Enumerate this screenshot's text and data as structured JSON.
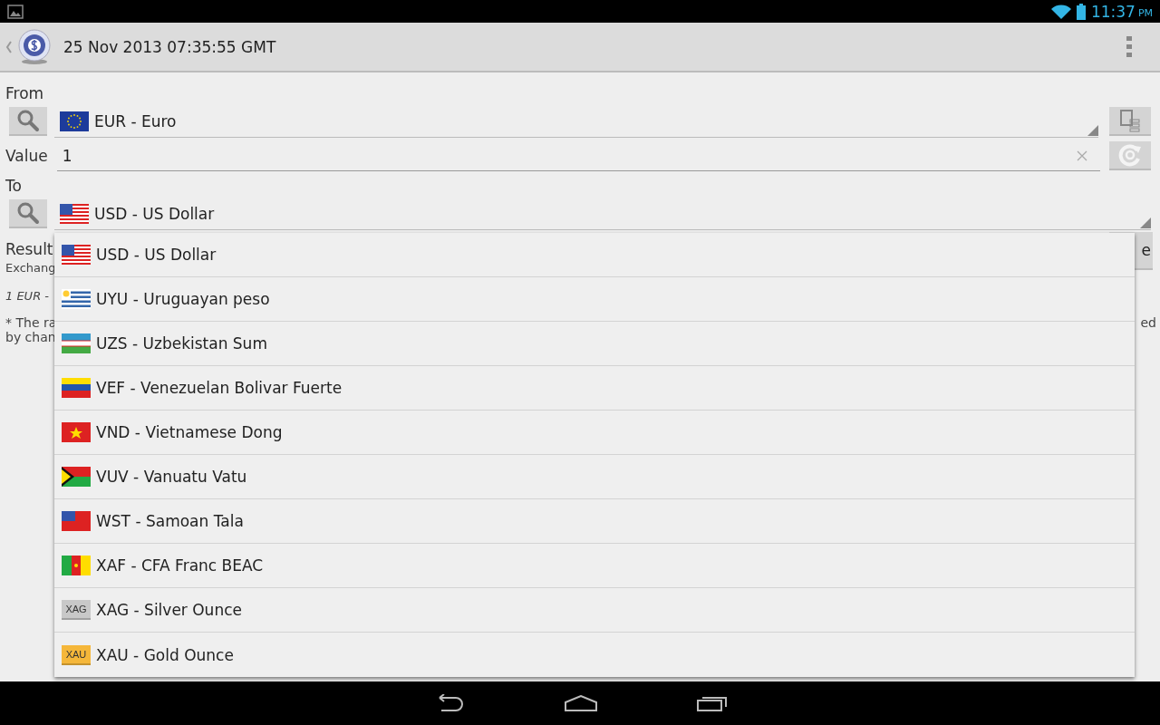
{
  "status_bar": {
    "time": "11:37",
    "ampm": "PM"
  },
  "action_bar": {
    "title": "25 Nov 2013 07:35:55 GMT"
  },
  "form": {
    "from_label": "From",
    "from_currency": "EUR - Euro",
    "value_label": "Value",
    "value": "1",
    "to_label": "To",
    "to_currency": "USD - US Dollar",
    "result_label": "Result",
    "exchange_text": "Exchang",
    "result_button_text": "e",
    "rate_text": "1 EUR -",
    "note_line_1": "* The ra",
    "note_line_2": "by chan",
    "note_end": "ed"
  },
  "dropdown": {
    "items": [
      {
        "label": "USD - US Dollar",
        "kind": "flag"
      },
      {
        "label": "UYU - Uruguayan peso",
        "kind": "flag"
      },
      {
        "label": "UZS - Uzbekistan Sum",
        "kind": "flag"
      },
      {
        "label": "VEF - Venezuelan Bolivar Fuerte",
        "kind": "flag"
      },
      {
        "label": "VND - Vietnamese Dong",
        "kind": "flag"
      },
      {
        "label": "VUV - Vanuatu Vatu",
        "kind": "flag"
      },
      {
        "label": "WST - Samoan Tala",
        "kind": "flag"
      },
      {
        "label": "XAF - CFA Franc BEAC",
        "kind": "flag"
      },
      {
        "label": "XAG - Silver Ounce",
        "kind": "badge",
        "badge": "XAG",
        "color": "#c8c8c8"
      },
      {
        "label": "XAU - Gold Ounce",
        "kind": "badge",
        "badge": "XAU",
        "color": "#f5b73a"
      }
    ]
  }
}
